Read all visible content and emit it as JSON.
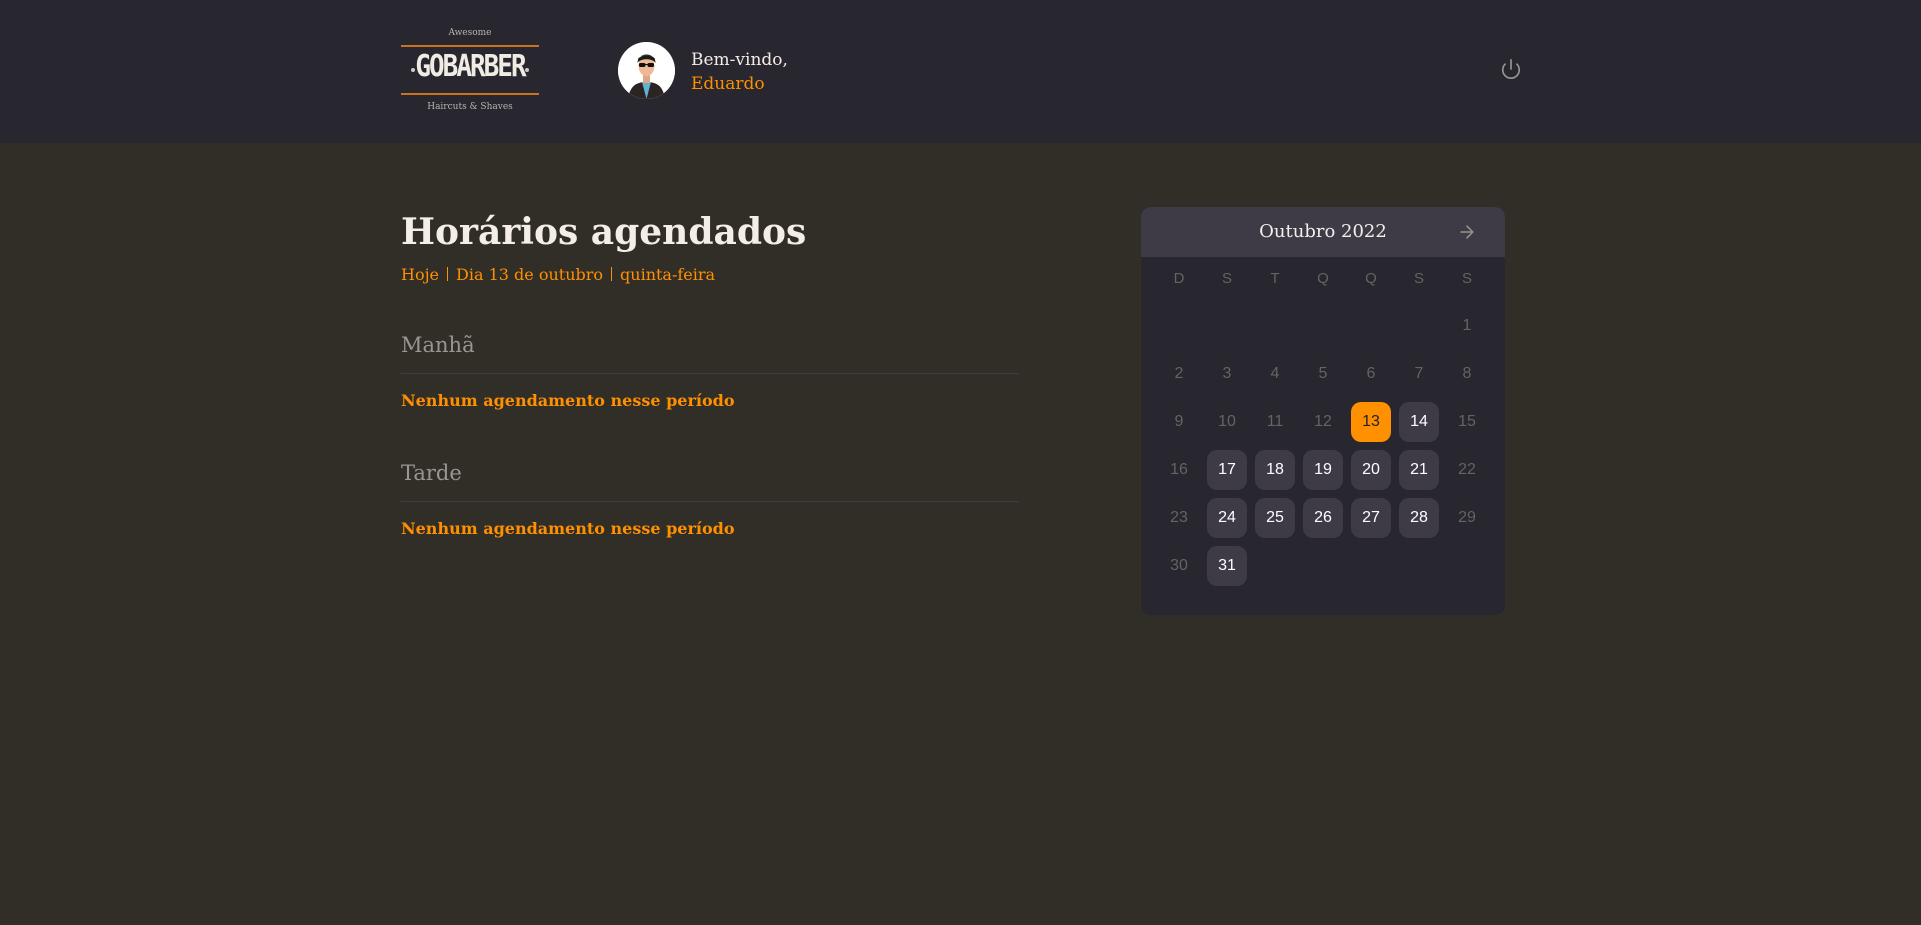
{
  "header": {
    "logo": {
      "top_text": "Awesome",
      "main_text": "GOBARBER",
      "bottom_text": "Haircuts & Shaves"
    },
    "welcome_text": "Bem-vindo,",
    "user_name": "Eduardo",
    "avatar_icon": "user-avatar",
    "signout_icon": "power-icon"
  },
  "main": {
    "title": "Horários agendados",
    "subtitle": {
      "today": "Hoje",
      "date": "Dia 13 de outubro",
      "weekday": "quinta-feira"
    },
    "sections": [
      {
        "title": "Manhã",
        "empty_message": "Nenhum agendamento nesse período"
      },
      {
        "title": "Tarde",
        "empty_message": "Nenhum agendamento nesse período"
      }
    ]
  },
  "calendar": {
    "month_label": "Outubro 2022",
    "next_icon": "arrow-right-icon",
    "weekdays": [
      "D",
      "S",
      "T",
      "Q",
      "Q",
      "S",
      "S"
    ],
    "days": [
      "1",
      "2",
      "3",
      "4",
      "5",
      "6",
      "7",
      "8",
      "9",
      "10",
      "11",
      "12",
      "13",
      "14",
      "15",
      "16",
      "17",
      "18",
      "19",
      "20",
      "21",
      "22",
      "23",
      "24",
      "25",
      "26",
      "27",
      "28",
      "29",
      "30",
      "31"
    ],
    "selected_day": "13",
    "available_days": [
      "14",
      "17",
      "18",
      "19",
      "20",
      "21",
      "24",
      "25",
      "26",
      "27",
      "28",
      "31"
    ]
  },
  "colors": {
    "accent": "#ff9000",
    "header_bg": "#28262e",
    "page_bg": "#312e27",
    "day_available_bg": "#3e3b47"
  }
}
